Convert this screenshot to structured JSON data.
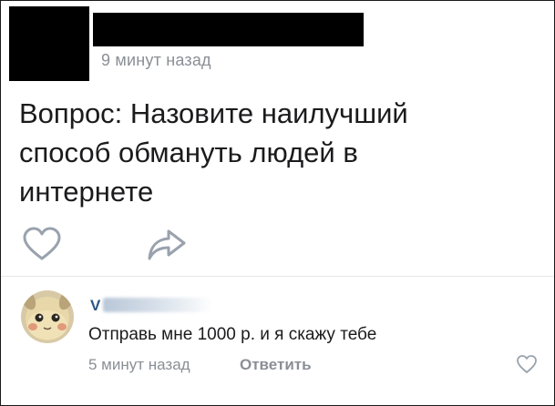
{
  "post": {
    "time": "9 минут назад",
    "text": "Вопрос: Назовите наилучший\nспособ обмануть людей в\nинтернете",
    "actions": {
      "like_icon": "heart-outline-icon",
      "share_icon": "share-arrow-icon"
    }
  },
  "comment": {
    "author_visible": "V",
    "text": "Отправь мне 1000 р. и я скажу тебе",
    "time": "5 минут назад",
    "reply_label": "Ответить",
    "like_icon": "heart-outline-icon"
  },
  "colors": {
    "name_link": "#2a5885",
    "muted": "#8a8f96",
    "icon_stroke": "#99a2ad",
    "text": "#1b1b1d"
  }
}
